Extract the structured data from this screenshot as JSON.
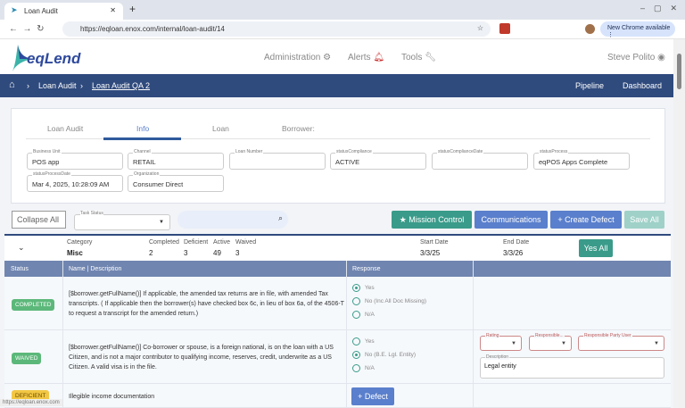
{
  "browser": {
    "tab_title": "Loan Audit",
    "url": "https://eqloan.enox.com/internal/loan-audit/14",
    "new_chrome": "New Chrome available",
    "status_url": "https://eqloan.enox.com"
  },
  "header": {
    "logo": "eqLend",
    "nav": [
      "Administration",
      "Alerts",
      "Tools"
    ],
    "user": "Steve Polito"
  },
  "breadcrumb": {
    "items": [
      "Loan Audit",
      "Loan Audit QA 2"
    ],
    "links": [
      "Pipeline",
      "Dashboard"
    ]
  },
  "tabs": [
    "Loan Audit",
    "Info",
    "Loan",
    "Borrower:"
  ],
  "fields": [
    {
      "label": "Business Unit",
      "value": "POS app"
    },
    {
      "label": "Channel",
      "value": "RETAIL"
    },
    {
      "label": "Loan Number",
      "value": ""
    },
    {
      "label": "statusCompliance",
      "value": "ACTIVE"
    },
    {
      "label": "statusComplianceDate",
      "value": ""
    },
    {
      "label": "statusProcess",
      "value": "eqPOS Apps Complete"
    },
    {
      "label": "statusProcessDate",
      "value": "Mar 4, 2025, 10:28:09 AM"
    },
    {
      "label": "Organization",
      "value": "Consumer Direct"
    }
  ],
  "toolbar": {
    "collapse": "Collapse All",
    "task_status_label": "Task Status",
    "mission": "Mission Control",
    "comms": "Communications",
    "create_defect": "Create Defect",
    "save_all": "Save All"
  },
  "category": {
    "category_label": "Category",
    "category": "Misc",
    "completed_label": "Completed",
    "completed": "2",
    "deficient_label": "Deficient",
    "deficient": "3",
    "active_label": "Active",
    "active": "49",
    "waived_label": "Waived",
    "waived": "3",
    "start_label": "Start Date",
    "start": "3/3/25",
    "end_label": "End Date",
    "end": "3/3/26",
    "yes_all": "Yes All"
  },
  "table": {
    "headers": [
      "Status",
      "Name | Description",
      "Response"
    ],
    "rows": [
      {
        "status": "COMPLETED",
        "desc": "[$borrower.getFullName()] If applicable, the amended tax returns are in file, with amended Tax transcripts. ( If applicable then the borrower(s) have checked box 6c, in lieu of box 6a, of the 4506-T to request a transcript for the amended return.)",
        "options": [
          "Yes",
          "No (Inc All Doc Missing)",
          "N/A"
        ]
      },
      {
        "status": "WAIVED",
        "desc": "[$borrower.getFullName()] Co-borrower or spouse, is a foreign national, is on the loan with a US Citizen, and is not a major contributor to qualifying income, reserves, credit, underwrite as a US Citizen. A valid visa is in the file.",
        "options": [
          "Yes",
          "No (B.E. Lgl. Entity)",
          "N/A"
        ],
        "rating_label": "Rating",
        "responsible_label": "Responsible...",
        "party_label": "Responsible Party User",
        "description_label": "Description",
        "description": "Legal entity"
      },
      {
        "status": "DEFICIENT",
        "desc": "Illegible income documentation",
        "defect": "Defect"
      }
    ]
  },
  "colors": {
    "navy": "#2f4a7d",
    "teal": "#3a9b8a",
    "blue": "#5a7fcc",
    "green": "#5cb87a",
    "yellow": "#f2c744"
  }
}
